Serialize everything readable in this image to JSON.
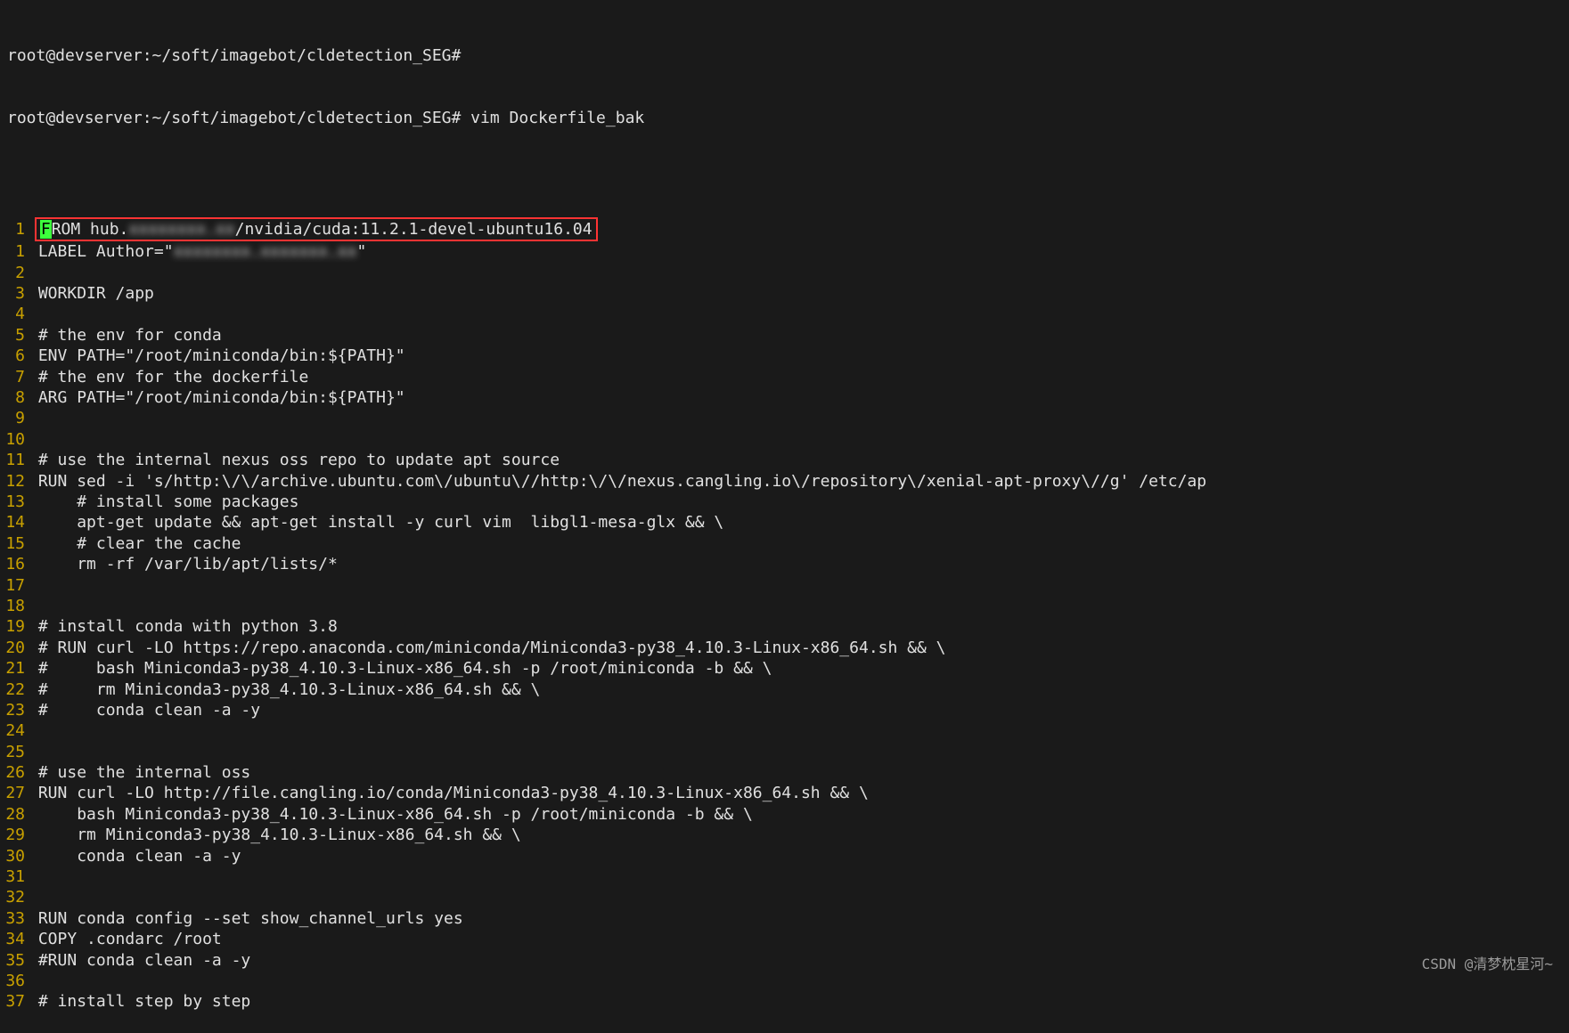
{
  "prompt": {
    "line1": "root@devserver:~/soft/imagebot/cldetection_SEG#",
    "line2": "root@devserver:~/soft/imagebot/cldetection_SEG# vim Dockerfile_bak"
  },
  "cursor_char": "F",
  "lines": [
    {
      "n": "1",
      "pre": "ROM hub.",
      "blur": "xxxxxxxx.xx",
      "post": "/nvidia/cuda:11.2.1-devel-ubuntu16.04",
      "is_from": true,
      "has_box": true
    },
    {
      "n": "1",
      "pre": "LABEL Author=\"",
      "blur": "xxxxxxxx.xxxxxxx.xx",
      "post": "\"",
      "is_from": false
    },
    {
      "n": "2",
      "text": ""
    },
    {
      "n": "3",
      "text": "WORKDIR /app"
    },
    {
      "n": "4",
      "text": ""
    },
    {
      "n": "5",
      "text": "# the env for conda"
    },
    {
      "n": "6",
      "text": "ENV PATH=\"/root/miniconda/bin:${PATH}\""
    },
    {
      "n": "7",
      "text": "# the env for the dockerfile"
    },
    {
      "n": "8",
      "text": "ARG PATH=\"/root/miniconda/bin:${PATH}\""
    },
    {
      "n": "9",
      "text": ""
    },
    {
      "n": "10",
      "text": ""
    },
    {
      "n": "11",
      "text": "# use the internal nexus oss repo to update apt source"
    },
    {
      "n": "12",
      "text": "RUN sed -i 's/http:\\/\\/archive.ubuntu.com\\/ubuntu\\//http:\\/\\/nexus.cangling.io\\/repository\\/xenial-apt-proxy\\//g' /etc/ap"
    },
    {
      "n": "13",
      "text": "    # install some packages"
    },
    {
      "n": "14",
      "text": "    apt-get update && apt-get install -y curl vim  libgl1-mesa-glx && \\"
    },
    {
      "n": "15",
      "text": "    # clear the cache"
    },
    {
      "n": "16",
      "text": "    rm -rf /var/lib/apt/lists/*"
    },
    {
      "n": "17",
      "text": ""
    },
    {
      "n": "18",
      "text": ""
    },
    {
      "n": "19",
      "text": "# install conda with python 3.8"
    },
    {
      "n": "20",
      "text": "# RUN curl -LO https://repo.anaconda.com/miniconda/Miniconda3-py38_4.10.3-Linux-x86_64.sh && \\"
    },
    {
      "n": "21",
      "text": "#     bash Miniconda3-py38_4.10.3-Linux-x86_64.sh -p /root/miniconda -b && \\"
    },
    {
      "n": "22",
      "text": "#     rm Miniconda3-py38_4.10.3-Linux-x86_64.sh && \\"
    },
    {
      "n": "23",
      "text": "#     conda clean -a -y"
    },
    {
      "n": "24",
      "text": ""
    },
    {
      "n": "25",
      "text": ""
    },
    {
      "n": "26",
      "text": "# use the internal oss"
    },
    {
      "n": "27",
      "text": "RUN curl -LO http://file.cangling.io/conda/Miniconda3-py38_4.10.3-Linux-x86_64.sh && \\"
    },
    {
      "n": "28",
      "text": "    bash Miniconda3-py38_4.10.3-Linux-x86_64.sh -p /root/miniconda -b && \\"
    },
    {
      "n": "29",
      "text": "    rm Miniconda3-py38_4.10.3-Linux-x86_64.sh && \\"
    },
    {
      "n": "30",
      "text": "    conda clean -a -y"
    },
    {
      "n": "31",
      "text": ""
    },
    {
      "n": "32",
      "text": ""
    },
    {
      "n": "33",
      "text": "RUN conda config --set show_channel_urls yes"
    },
    {
      "n": "34",
      "text": "COPY .condarc /root"
    },
    {
      "n": "35",
      "text": "#RUN conda clean -a -y"
    },
    {
      "n": "36",
      "text": ""
    },
    {
      "n": "37",
      "text": "# install step by step"
    }
  ],
  "watermark": "CSDN @清梦枕星河~"
}
